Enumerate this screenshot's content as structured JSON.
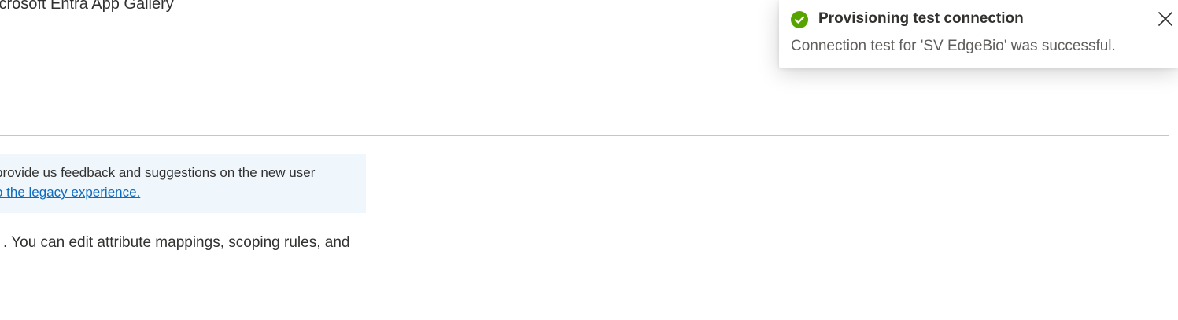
{
  "header": {
    "app_source_text": "icrosoft Entra App Gallery"
  },
  "info_banner": {
    "line1": "provide us feedback and suggestions on the new user",
    "link_text": "o the legacy experience."
  },
  "description": {
    "text": ". You can edit attribute mappings, scoping rules, and"
  },
  "toast": {
    "title": "Provisioning test connection",
    "message": "Connection test for 'SV EdgeBio' was successful.",
    "status_icon": "check-circle-icon",
    "close_icon": "close-icon",
    "success_color": "#57a300"
  },
  "colors": {
    "banner_background": "#eff6fc",
    "link": "#0f6cbd"
  }
}
